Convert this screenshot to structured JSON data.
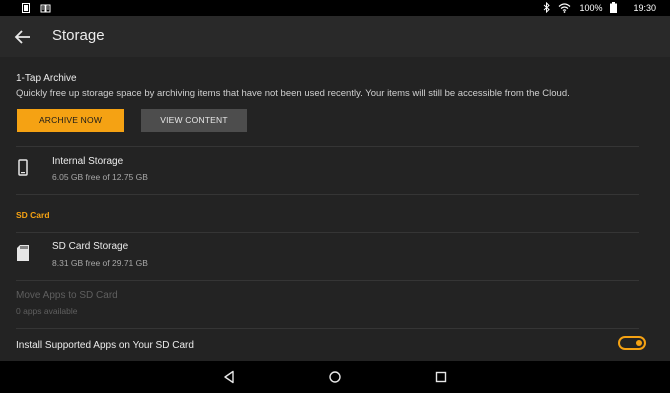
{
  "status_bar": {
    "battery": "100%",
    "time": "19:30",
    "icons": [
      "notification-icon",
      "book-icon",
      "bluetooth-icon",
      "wifi-icon",
      "battery-icon"
    ]
  },
  "header": {
    "title": "Storage"
  },
  "archive": {
    "title": "1-Tap Archive",
    "description": "Quickly free up storage space by archiving items that have not been used recently. Your items will still be accessible from the Cloud.",
    "archive_button": "ARCHIVE NOW",
    "view_button": "VIEW CONTENT"
  },
  "internal_storage": {
    "title": "Internal Storage",
    "detail": "6.05 GB free of 12.75 GB"
  },
  "sd_card": {
    "section_label": "SD Card",
    "title": "SD Card Storage",
    "detail": "8.31 GB free of 29.71 GB"
  },
  "move_apps": {
    "title": "Move Apps to SD Card",
    "detail": "0 apps available"
  },
  "install_apps": {
    "title": "Install Supported Apps on Your SD Card",
    "enabled": true
  },
  "colors": {
    "accent": "#f5a213",
    "background": "#232323",
    "appbar": "#292929"
  }
}
